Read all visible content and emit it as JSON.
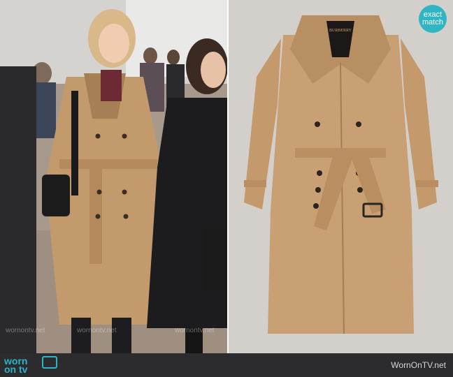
{
  "badge": {
    "line1": "exact",
    "line2": "match"
  },
  "footer": {
    "logo_line1": "worn",
    "logo_line2": "on tv",
    "site": "WornOnTV.net"
  },
  "watermarks": [
    "wornontv.net",
    "wornontv.net",
    "wornontv.net"
  ],
  "colors": {
    "accent": "#2fb5c3",
    "footer_bg": "#2c2c2e",
    "coat": "#c79b6a",
    "right_bg": "#d3d0cc"
  }
}
